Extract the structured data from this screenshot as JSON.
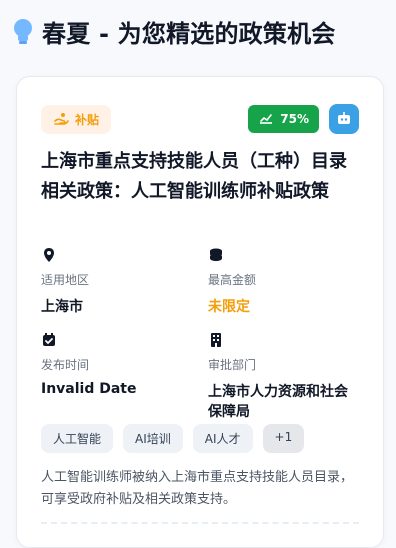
{
  "header": {
    "title": "春夏 - 为您精选的政策机会",
    "icon": "lightbulb-icon"
  },
  "card": {
    "badges": {
      "subsidy_label": "补贴",
      "percent_label": "75%",
      "robot_icon": "robot-icon",
      "chart_icon": "trend-chart-icon",
      "hand_icon": "hand-coins-icon"
    },
    "policy_title": "上海市重点支持技能人员（工种）目录相关政策：人工智能训练师补贴政策",
    "info": {
      "region_label": "适用地区",
      "region_value": "上海市",
      "amount_label": "最高金额",
      "amount_value": "未限定",
      "publish_label": "发布时间",
      "publish_value": "Invalid Date",
      "dept_label": "审批部门",
      "dept_value": "上海市人力资源和社会保障局"
    },
    "tags": [
      "人工智能",
      "AI培训",
      "AI人才",
      "+1"
    ],
    "description": "人工智能训练师被纳入上海市重点支持技能人员目录，可享受政府补贴及相关政策支持。"
  },
  "colors": {
    "accent_orange": "#f59e0b",
    "accent_green": "#16a34a",
    "accent_blue": "#3aa1e5"
  }
}
